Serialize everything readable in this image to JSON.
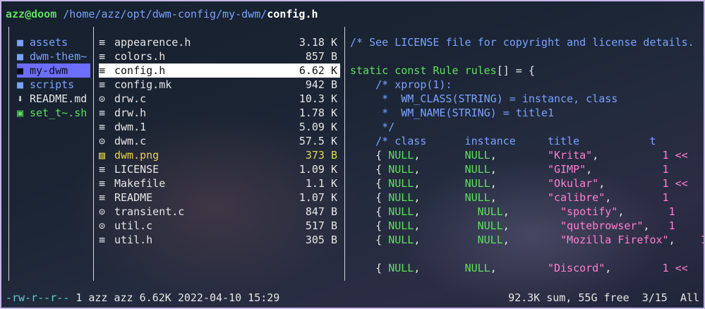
{
  "header": {
    "user_host": "azz@doom",
    "path": " /home/azz/opt/dwm-config/my-dwm/",
    "file": "config.h"
  },
  "parent_dir": [
    {
      "icon": "folder-icon",
      "glyph": "■",
      "name": "assets",
      "kind": "dir"
    },
    {
      "icon": "folder-icon",
      "glyph": "■",
      "name": "dwm-them~",
      "kind": "dir"
    },
    {
      "icon": "folder-icon",
      "glyph": "■",
      "name": "my-dwm",
      "kind": "dir",
      "selected": true
    },
    {
      "icon": "folder-icon",
      "glyph": "■",
      "name": "scripts",
      "kind": "dir"
    },
    {
      "icon": "download-icon",
      "glyph": "⬇",
      "name": "README.md",
      "kind": "file"
    },
    {
      "icon": "terminal-icon",
      "glyph": "▣",
      "name": "set_t~.sh",
      "kind": "exec"
    }
  ],
  "current_dir": [
    {
      "icon": "text-file-icon",
      "glyph": "≡",
      "name": "appearence.h",
      "size": "3.18 K"
    },
    {
      "icon": "text-file-icon",
      "glyph": "≡",
      "name": "colors.h",
      "size": "857 B"
    },
    {
      "icon": "text-file-icon",
      "glyph": "≡",
      "name": "config.h",
      "size": "6.62 K",
      "selected": true
    },
    {
      "icon": "text-file-icon",
      "glyph": "≡",
      "name": "config.mk",
      "size": "942 B"
    },
    {
      "icon": "c-file-icon",
      "glyph": "⊙",
      "name": "drw.c",
      "size": "10.3 K"
    },
    {
      "icon": "text-file-icon",
      "glyph": "≡",
      "name": "drw.h",
      "size": "1.78 K"
    },
    {
      "icon": "text-file-icon",
      "glyph": "≡",
      "name": "dwm.1",
      "size": "5.09 K"
    },
    {
      "icon": "c-file-icon",
      "glyph": "⊙",
      "name": "dwm.c",
      "size": "57.5 K"
    },
    {
      "icon": "image-file-icon",
      "glyph": "▨",
      "name": "dwm.png",
      "size": "373 B",
      "image": true
    },
    {
      "icon": "text-file-icon",
      "glyph": "≡",
      "name": "LICENSE",
      "size": "1.09 K"
    },
    {
      "icon": "text-file-icon",
      "glyph": "≡",
      "name": "Makefile",
      "size": "1.1 K"
    },
    {
      "icon": "text-file-icon",
      "glyph": "≡",
      "name": "README",
      "size": "1.07 K"
    },
    {
      "icon": "c-file-icon",
      "glyph": "⊙",
      "name": "transient.c",
      "size": "847 B"
    },
    {
      "icon": "c-file-icon",
      "glyph": "⊙",
      "name": "util.c",
      "size": "517 B"
    },
    {
      "icon": "text-file-icon",
      "glyph": "≡",
      "name": "util.h",
      "size": "305 B"
    }
  ],
  "preview": [
    [
      [
        "cm",
        "/* See LICENSE file for copyright and license details. "
      ]
    ],
    [],
    [
      [
        "kw",
        "static const "
      ],
      [
        "ty",
        "Rule"
      ],
      [
        "wh",
        " "
      ],
      [
        "kw",
        "rules"
      ],
      [
        "wh",
        "[] = {"
      ]
    ],
    [
      [
        "cm",
        "    /* xprop(1):"
      ]
    ],
    [
      [
        "cm",
        "     *  WM_CLASS(STRING) = instance, class"
      ]
    ],
    [
      [
        "cm",
        "     *  WM_NAME(STRING) = title1"
      ]
    ],
    [
      [
        "cm",
        "     */"
      ]
    ],
    [
      [
        "cm",
        "    /* class      instance     title           t"
      ]
    ],
    [
      [
        "wh",
        "    { "
      ],
      [
        "nu",
        "NULL"
      ],
      [
        "wh",
        ",       "
      ],
      [
        "nu",
        "NULL"
      ],
      [
        "wh",
        ",        "
      ],
      [
        "st",
        "\"Krita\""
      ],
      [
        "wh",
        ",          "
      ],
      [
        "pk",
        "1 <<"
      ]
    ],
    [
      [
        "wh",
        "    { "
      ],
      [
        "nu",
        "NULL"
      ],
      [
        "wh",
        ",       "
      ],
      [
        "nu",
        "NULL"
      ],
      [
        "wh",
        ",        "
      ],
      [
        "st",
        "\"GIMP\""
      ],
      [
        "wh",
        ",           "
      ],
      [
        "pk",
        "1"
      ]
    ],
    [
      [
        "wh",
        "    { "
      ],
      [
        "nu",
        "NULL"
      ],
      [
        "wh",
        ",       "
      ],
      [
        "nu",
        "NULL"
      ],
      [
        "wh",
        ",        "
      ],
      [
        "st",
        "\"Okular\""
      ],
      [
        "wh",
        ",         "
      ],
      [
        "pk",
        "1 <<"
      ]
    ],
    [
      [
        "wh",
        "    { "
      ],
      [
        "nu",
        "NULL"
      ],
      [
        "wh",
        ",       "
      ],
      [
        "nu",
        "NULL"
      ],
      [
        "wh",
        ",        "
      ],
      [
        "st",
        "\"calibre\""
      ],
      [
        "wh",
        ",        "
      ],
      [
        "pk",
        "1"
      ]
    ],
    [
      [
        "wh",
        "    { "
      ],
      [
        "nu",
        "NULL"
      ],
      [
        "wh",
        ",         "
      ],
      [
        "nu",
        "NULL"
      ],
      [
        "wh",
        ",        "
      ],
      [
        "st",
        "\"spotify\""
      ],
      [
        "wh",
        ",       "
      ],
      [
        "pk",
        "1"
      ]
    ],
    [
      [
        "wh",
        "    { "
      ],
      [
        "nu",
        "NULL"
      ],
      [
        "wh",
        ",         "
      ],
      [
        "nu",
        "NULL"
      ],
      [
        "wh",
        ",        "
      ],
      [
        "st",
        "\"qutebrowser\""
      ],
      [
        "wh",
        ",   "
      ],
      [
        "pk",
        "1"
      ]
    ],
    [
      [
        "wh",
        "    { "
      ],
      [
        "nu",
        "NULL"
      ],
      [
        "wh",
        ",         "
      ],
      [
        "nu",
        "NULL"
      ],
      [
        "wh",
        ",        "
      ],
      [
        "st",
        "\"Mozilla Firefox\""
      ],
      [
        "wh",
        ",    "
      ],
      [
        "pk",
        "1"
      ]
    ],
    [],
    [
      [
        "wh",
        "    { "
      ],
      [
        "nu",
        "NULL"
      ],
      [
        "wh",
        ",       "
      ],
      [
        "nu",
        "NULL"
      ],
      [
        "wh",
        ",        "
      ],
      [
        "st",
        "\"Discord\""
      ],
      [
        "wh",
        ",        "
      ],
      [
        "pk",
        "1 <<"
      ]
    ]
  ],
  "status": {
    "permissions": "-rw-r--r--",
    "info": " 1 azz azz 6.62K 2022-04-10 15:29",
    "summary": "92.3K sum, 55G free  3/15  All"
  }
}
